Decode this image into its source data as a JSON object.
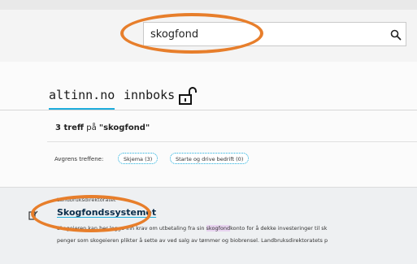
{
  "search": {
    "value": "skogfond"
  },
  "nav": {
    "altinn": "altinn.no",
    "inbox": "innboks"
  },
  "results": {
    "count_prefix": "3 treff",
    "count_mid": " på ",
    "query_quoted": "\"skogfond\""
  },
  "filters": {
    "label": "Avgrens treffene:",
    "chips": [
      "Skjema (3)",
      "Starte og drive bedrift (0)"
    ]
  },
  "result": {
    "org": "Landbruksdirektoratet",
    "title": "Skogfondssystemet",
    "desc_1_pre": "Skogeieren kan her legge inn krav om utbetaling fra sin ",
    "desc_1_hl": "skogfond",
    "desc_1_post": "konto for å dekke investeringer til sk",
    "desc_2": "penger som skogeieren plikter å sette av ved salg av tømmer og biobrensel. Landbruksdirektoratets p"
  },
  "annotation_color": "#e77e2b",
  "accent_color": "#1eaddc",
  "icons": [
    "search-icon",
    "lock-open-icon",
    "form-icon"
  ]
}
